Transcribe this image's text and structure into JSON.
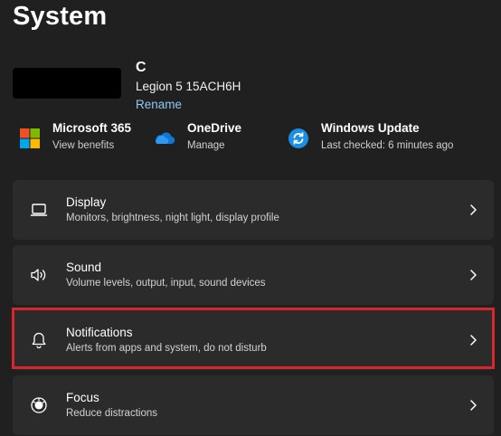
{
  "page": {
    "title": "System"
  },
  "device": {
    "name": "C",
    "model": "Legion 5 15ACH6H",
    "rename_label": "Rename"
  },
  "quick_links": [
    {
      "title": "Microsoft 365",
      "subtitle": "View benefits",
      "icon": "microsoft-logo-icon"
    },
    {
      "title": "OneDrive",
      "subtitle": "Manage",
      "icon": "onedrive-cloud-icon"
    },
    {
      "title": "Windows Update",
      "subtitle": "Last checked: 6 minutes ago",
      "icon": "windows-update-icon"
    }
  ],
  "settings": [
    {
      "title": "Display",
      "subtitle": "Monitors, brightness, night light, display profile",
      "icon": "monitor-icon"
    },
    {
      "title": "Sound",
      "subtitle": "Volume levels, output, input, sound devices",
      "icon": "speaker-icon"
    },
    {
      "title": "Notifications",
      "subtitle": "Alerts from apps and system, do not disturb",
      "icon": "bell-icon"
    },
    {
      "title": "Focus",
      "subtitle": "Reduce distractions",
      "icon": "focus-icon"
    }
  ],
  "colors": {
    "background": "#202020",
    "card": "#2b2b2b",
    "link": "#8ec8f6",
    "highlight": "#d7262e"
  }
}
